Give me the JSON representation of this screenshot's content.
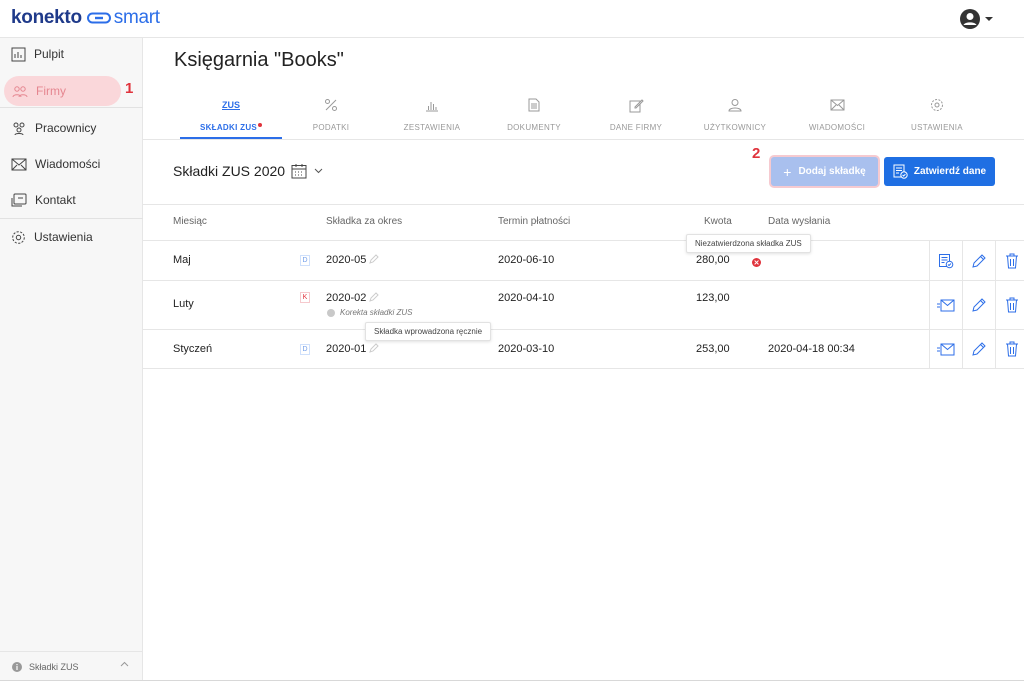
{
  "app": {
    "brand_main": "konekto",
    "brand_sub": "smart"
  },
  "colors": {
    "accent": "#2c6ee8",
    "brand": "#1f3a8a",
    "danger": "#e0333c",
    "highlight": "#fad7da"
  },
  "sidebar": {
    "items": [
      {
        "label": "Pulpit",
        "icon": "dashboard-icon"
      },
      {
        "label": "Firmy",
        "icon": "companies-icon"
      },
      {
        "label": "Pracownicy",
        "icon": "employees-icon"
      },
      {
        "label": "Wiadomości",
        "icon": "envelope-icon"
      },
      {
        "label": "Kontakt",
        "icon": "contact-icon"
      },
      {
        "label": "Ustawienia",
        "icon": "gear-icon"
      }
    ],
    "marker": "1",
    "footer_label": "Składki ZUS"
  },
  "page": {
    "title": "Księgarnia \"Books\"",
    "tabs": [
      {
        "label": "SKŁADKI ZUS",
        "icon_text": "ZUS",
        "active": true
      },
      {
        "label": "PODATKI",
        "icon": "percent-icon"
      },
      {
        "label": "ZESTAWIENIA",
        "icon": "bar-chart-icon"
      },
      {
        "label": "DOKUMENTY",
        "icon": "document-icon"
      },
      {
        "label": "DANE FIRMY",
        "icon": "edit-icon"
      },
      {
        "label": "UŻYTKOWNICY",
        "icon": "user-icon"
      },
      {
        "label": "WIADOMOŚCI",
        "icon": "envelope-icon"
      },
      {
        "label": "USTAWIENIA",
        "icon": "gear-icon"
      }
    ]
  },
  "section": {
    "title": "Składki ZUS 2020",
    "marker": "2",
    "add_button": "Dodaj składkę",
    "confirm_button": "Zatwierdź dane"
  },
  "table": {
    "headers": [
      "Miesiąc",
      "Składka za okres",
      "Termin płatności",
      "Kwota",
      "Data wysłania"
    ],
    "rows": [
      {
        "month": "Maj",
        "badge": "D",
        "period": "2020-05",
        "due": "2020-06-10",
        "amount": "280,00",
        "sent": "",
        "status_error": true
      },
      {
        "month": "Luty",
        "badge": "K",
        "period": "2020-02",
        "note": "Korekta składki ZUS",
        "due": "2020-04-10",
        "amount": "123,00",
        "sent": ""
      },
      {
        "month": "Styczeń",
        "badge": "D",
        "period": "2020-01",
        "due": "2020-03-10",
        "amount": "253,00",
        "sent": "2020-04-18 00:34"
      }
    ],
    "tooltip_unconfirmed": "Niezatwierdzona składka ZUS",
    "tooltip_manual": "Składka wprowadzona ręcznie"
  }
}
